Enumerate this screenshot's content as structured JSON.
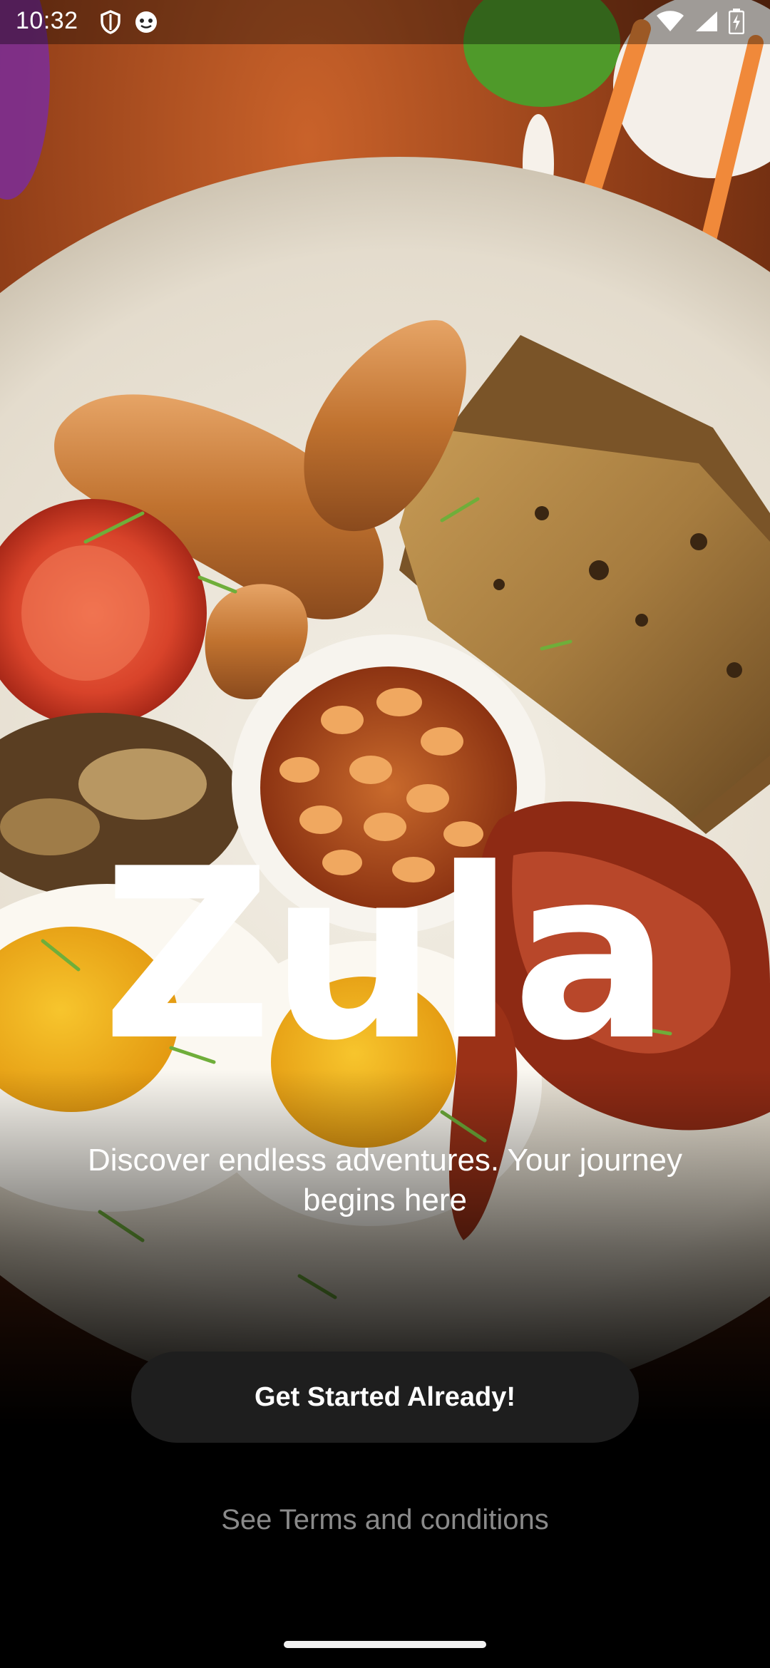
{
  "status_bar": {
    "time": "10:32",
    "left_icons": [
      "shield-icon",
      "cat-face-icon"
    ],
    "right_icons": [
      "wifi-icon",
      "cellular-signal-icon",
      "battery-charging-icon"
    ]
  },
  "brand": {
    "logo_text": "Zula",
    "tagline": "Discover endless adventures. Your journey begins here"
  },
  "actions": {
    "primary_label": "Get Started Already!",
    "terms_label": "See Terms and conditions"
  },
  "colors": {
    "background": "#000000",
    "button_bg": "#1e1e1e",
    "text_primary": "#ffffff",
    "text_muted": "#8a8a8a"
  }
}
